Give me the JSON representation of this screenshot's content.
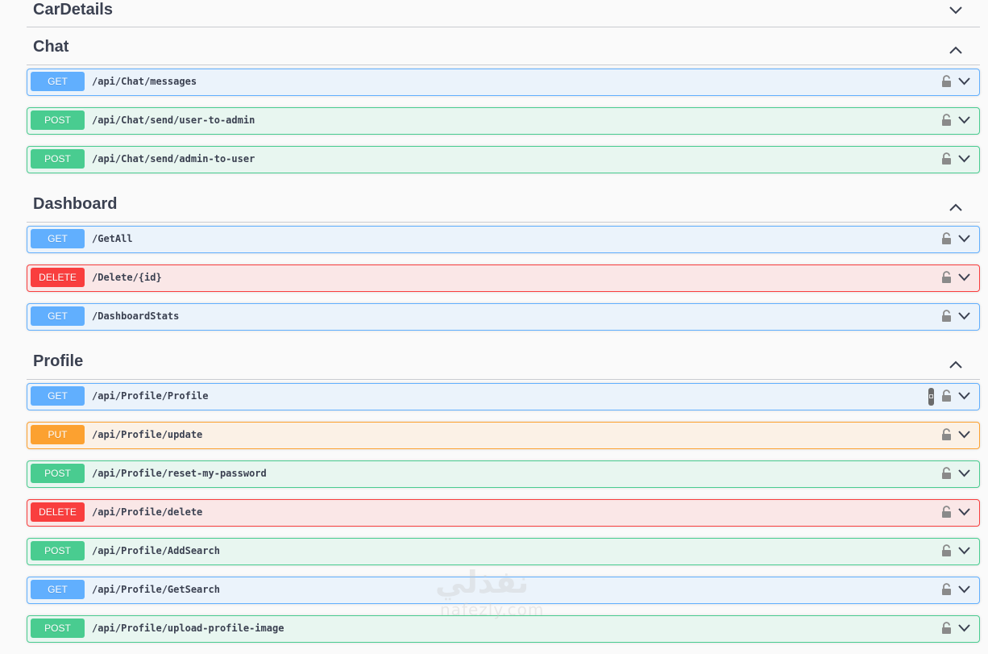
{
  "sections": [
    {
      "title": "CarDetails",
      "expanded": false,
      "operations": []
    },
    {
      "title": "Chat",
      "expanded": true,
      "operations": [
        {
          "method": "GET",
          "path": "/api/Chat/messages"
        },
        {
          "method": "POST",
          "path": "/api/Chat/send/user-to-admin"
        },
        {
          "method": "POST",
          "path": "/api/Chat/send/admin-to-user"
        }
      ]
    },
    {
      "title": "Dashboard",
      "expanded": true,
      "operations": [
        {
          "method": "GET",
          "path": "/GetAll"
        },
        {
          "method": "DELETE",
          "path": "/Delete/{id}"
        },
        {
          "method": "GET",
          "path": "/DashboardStats"
        }
      ]
    },
    {
      "title": "Profile",
      "expanded": true,
      "operations": [
        {
          "method": "GET",
          "path": "/api/Profile/Profile"
        },
        {
          "method": "PUT",
          "path": "/api/Profile/update"
        },
        {
          "method": "POST",
          "path": "/api/Profile/reset-my-password"
        },
        {
          "method": "DELETE",
          "path": "/api/Profile/delete"
        },
        {
          "method": "POST",
          "path": "/api/Profile/AddSearch"
        },
        {
          "method": "GET",
          "path": "/api/Profile/GetSearch"
        },
        {
          "method": "POST",
          "path": "/api/Profile/upload-profile-image"
        }
      ]
    }
  ],
  "icons": {
    "lock": "lock-icon",
    "chevron_up": "chevron-up-icon",
    "chevron_down": "chevron-down-icon",
    "copy": "copy-icon"
  },
  "colors": {
    "get": "#61affe",
    "post": "#49cc90",
    "delete": "#f93e3e",
    "put": "#fca130"
  },
  "watermark": {
    "arabic": "نفذلي",
    "latin": "nafezly.com"
  }
}
